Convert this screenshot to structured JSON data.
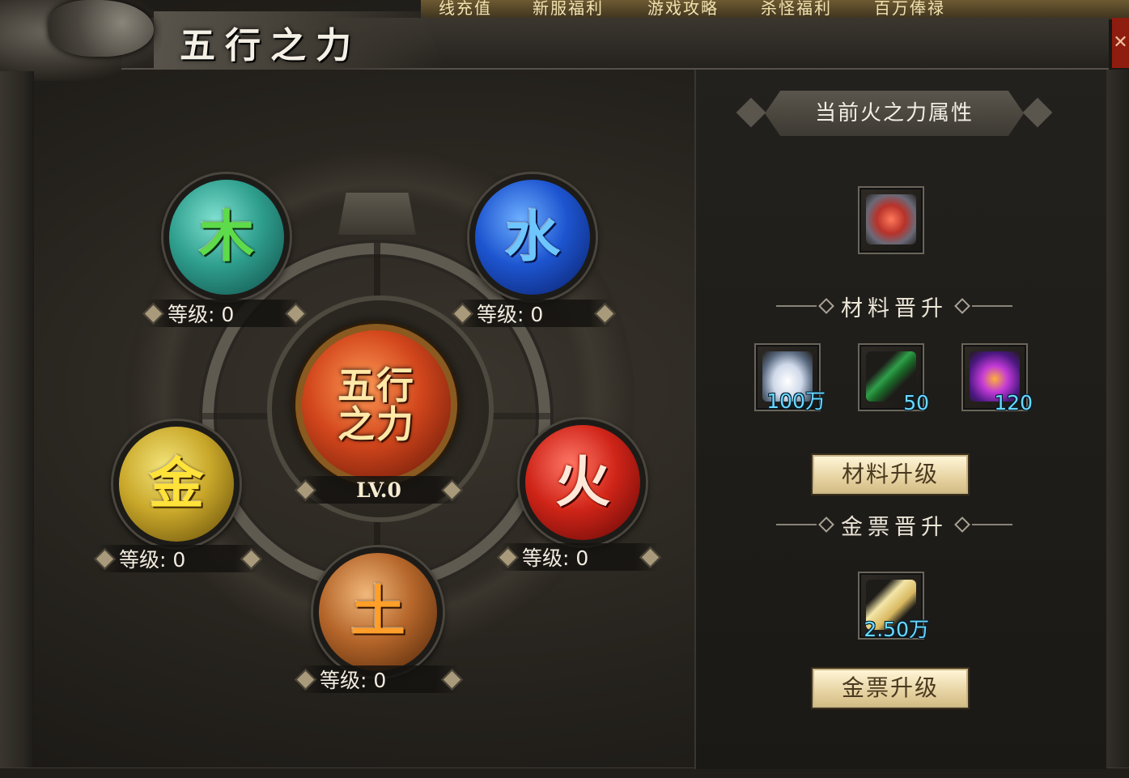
{
  "window": {
    "title": "五行之力",
    "close_icon": "close-icon"
  },
  "top_nav": {
    "items": [
      "线充值",
      "新服福利",
      "游戏攻略",
      "杀怪福利",
      "百万俸禄"
    ]
  },
  "elements": {
    "wood": {
      "glyph": "木",
      "level_text": "等级: 0"
    },
    "water": {
      "glyph": "水",
      "level_text": "等级: 0"
    },
    "metal": {
      "glyph": "金",
      "level_text": "等级: 0"
    },
    "fire": {
      "glyph": "火",
      "level_text": "等级: 0"
    },
    "earth": {
      "glyph": "土",
      "level_text": "等级: 0"
    },
    "core": {
      "glyph_line1": "五行",
      "glyph_line2": "之力",
      "level_text": "LV.0"
    }
  },
  "side_panel": {
    "header": "当前火之力属性",
    "attr_item_icon": "fire-charm-icon",
    "material_section": "材料晋升",
    "materials": [
      {
        "icon": "silver-ingot-icon",
        "qty": "100万",
        "color": "#dfe8f5"
      },
      {
        "icon": "jade-flute-icon",
        "qty": "50",
        "color": "#2fa04a"
      },
      {
        "icon": "purple-flame-orb-icon",
        "qty": "120",
        "color": "#8a2bd6"
      }
    ],
    "material_button": "材料升级",
    "ticket_section": "金票晋升",
    "ticket": {
      "icon": "gold-ticket-icon",
      "qty": "2.50万"
    },
    "ticket_button": "金票升级"
  },
  "colors": {
    "qty_text": "#6ad8ff",
    "button_bg": "#f0e0b4",
    "close_bg": "#8e1c0f"
  }
}
